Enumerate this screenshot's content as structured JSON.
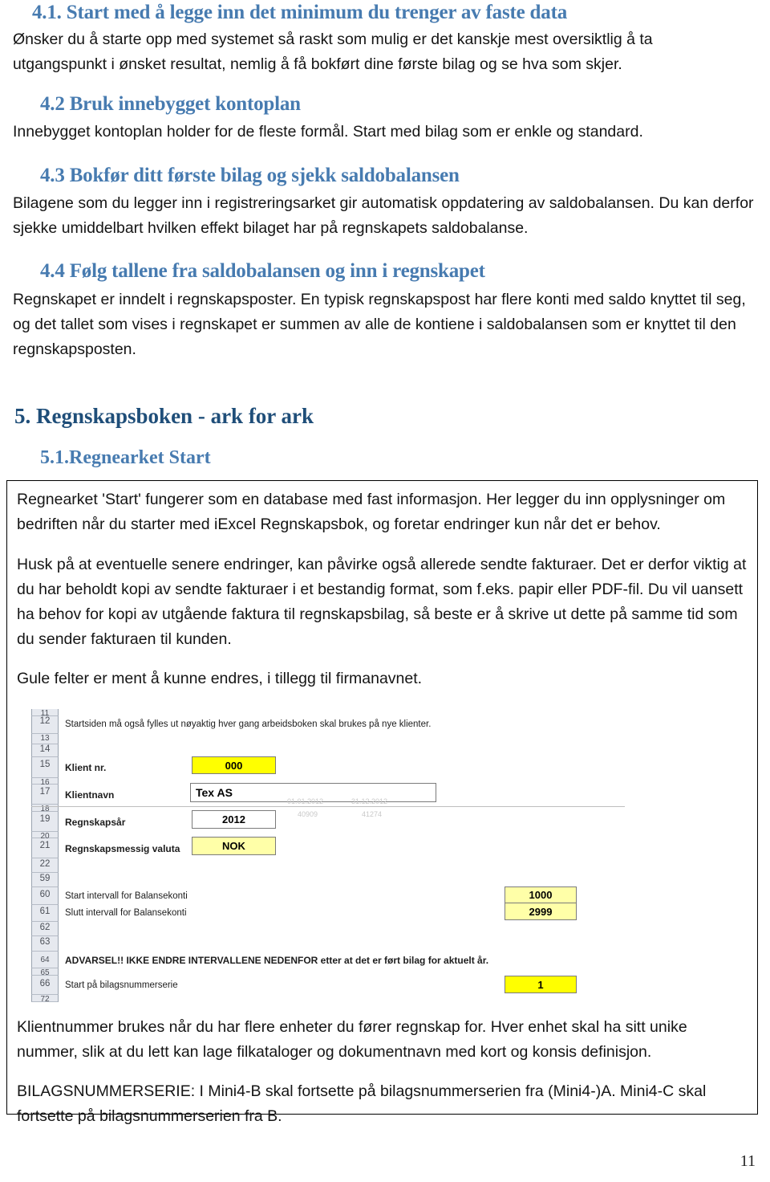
{
  "document": {
    "page_number": "11"
  },
  "sections": [
    {
      "heading": "4.1. Start med å legge inn det minimum du trenger av faste data",
      "paragraphs": [
        "Ønsker du å starte opp med systemet så raskt som mulig er det kanskje mest oversiktlig å ta utgangspunkt i ønsket resultat, nemlig å få bokført dine første bilag og se hva som skjer."
      ]
    },
    {
      "heading": "4.2 Bruk innebygget kontoplan",
      "paragraphs": [
        "Innebygget kontoplan holder for de fleste formål. Start med bilag som er enkle og standard."
      ]
    },
    {
      "heading": "4.3 Bokfør ditt første bilag og sjekk saldobalansen",
      "paragraphs": [
        "Bilagene som du legger inn i registreringsarket gir automatisk oppdatering av saldobalansen. Du kan derfor sjekke umiddelbart hvilken effekt bilaget har på regnskapets saldobalanse."
      ]
    },
    {
      "heading": "4.4 Følg tallene fra saldobalansen og inn i regnskapet",
      "paragraphs": [
        "Regnskapet er inndelt i regnskapsposter. En typisk regnskapspost har flere konti med saldo knyttet til seg, og det tallet som vises i regnskapet er summen av alle de kontiene i saldobalansen som er knyttet til den regnskapsposten."
      ]
    }
  ],
  "chapter5": {
    "heading": "5.  Regnskapsboken - ark for ark",
    "subheading": "5.1.Regnearket Start"
  },
  "boxed_content": {
    "paragraphs": [
      "Regnearket 'Start' fungerer som en database med fast informasjon. Her legger du inn opplysninger om bedriften når du starter med iExcel Regnskapsbok, og foretar endringer kun når det er behov.",
      "Husk på at eventuelle senere endringer, kan påvirke også allerede sendte fakturaer. Det er derfor viktig at du har beholdt kopi av sendte fakturaer i et bestandig format, som f.eks. papir eller PDF-fil. Du vil uansett ha behov for kopi av utgående faktura til regnskapsbilag, så beste er å skrive ut dette på samme tid som du sender fakturaen til kunden.",
      "Gule felter er ment å kunne endres, i tillegg til firmanavnet."
    ],
    "after_screenshot_paragraphs": [
      "Klientnummer brukes når du har flere enheter du fører regnskap for. Hver enhet skal ha sitt unike nummer, slik at du lett kan lage filkataloger og dokumentnavn med kort og konsis definisjon.",
      "BILAGSNUMMERSERIE: I Mini4-B skal fortsette på bilagsnummerserien fra (Mini4-)A. Mini4-C skal fortsette på bilagsnummerserien fra B."
    ]
  },
  "spreadsheet": {
    "row_numbers": [
      "11",
      "12",
      "13",
      "14",
      "15",
      "16",
      "17",
      "18",
      "19",
      "20",
      "21",
      "22",
      "59",
      "60",
      "61",
      "62",
      "63",
      "64",
      "65",
      "66",
      "72"
    ],
    "labels": {
      "intro": "Startsiden må også fylles ut nøyaktig hver gang arbeidsboken skal brukes på nye klienter.",
      "klient_nr": "Klient nr.",
      "klientnavn": "Klientnavn",
      "regnskapsaar": "Regnskapsår",
      "valuta": "Regnskapsmessig valuta",
      "start_intervall": "Start intervall for Balansekonti",
      "slutt_intervall": "Slutt intervall for Balansekonti",
      "advarsel": "ADVARSEL!! IKKE ENDRE INTERVALLENE NEDENFOR etter at det er ført bilag for aktuelt år.",
      "start_bilagsserie": "Start på  bilagsnummerserie"
    },
    "values": {
      "klient_nr": "000",
      "klientnavn": "Tex AS",
      "regnskapsaar": "2012",
      "valuta": "NOK",
      "start_intervall": "1000",
      "slutt_intervall": "2999",
      "start_bilagsserie": "1"
    },
    "faint_values": {
      "date_from": "01.01.2012",
      "date_to": "31.12.2012",
      "serial_from": "40909",
      "serial_to": "41274"
    },
    "colors": {
      "editable_strong": "#ffff00",
      "editable_soft": "#ffffa8",
      "row_header_bg": "#e6e9ef"
    }
  }
}
